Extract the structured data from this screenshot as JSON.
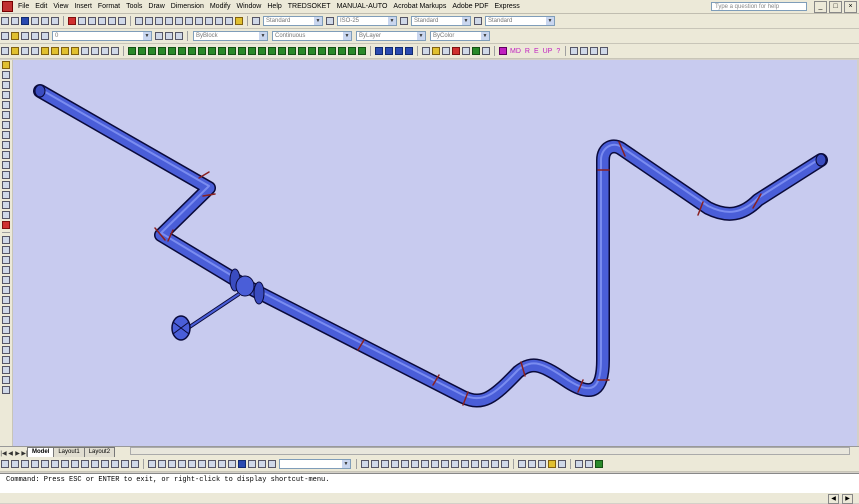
{
  "menu": [
    "File",
    "Edit",
    "View",
    "Insert",
    "Format",
    "Tools",
    "Draw",
    "Dimension",
    "Modify",
    "Window",
    "Help",
    "TREDSOKET",
    "MANUAL-AUTO",
    "Acrobat Markups",
    "Adobe PDF",
    "Express"
  ],
  "help_placeholder": "Type a question for help",
  "window_buttons": [
    "_",
    "□",
    "×"
  ],
  "styles_toolbar": {
    "text_style": "Standard",
    "dim_style": "ISO-25",
    "table_style": "Standard",
    "multileader_style": "Standard"
  },
  "layers_toolbar": {
    "layer": "0",
    "color": "ByBlock",
    "linetype": "Continuous",
    "lineweight": "ByLayer",
    "plotstyle": "ByColor"
  },
  "right_toolbar_text": [
    "MD",
    "R",
    "E",
    "UP",
    "?"
  ],
  "tabs": {
    "model": "Model",
    "layout1": "Layout1",
    "layout2": "Layout2"
  },
  "command_line": "Command: Press ESC or ENTER to exit, or right-click to display shortcut-menu.",
  "colors": {
    "background": "#c8cbef",
    "pipe": "#4a5ed8",
    "pipe_edge": "#0a0a3a"
  }
}
